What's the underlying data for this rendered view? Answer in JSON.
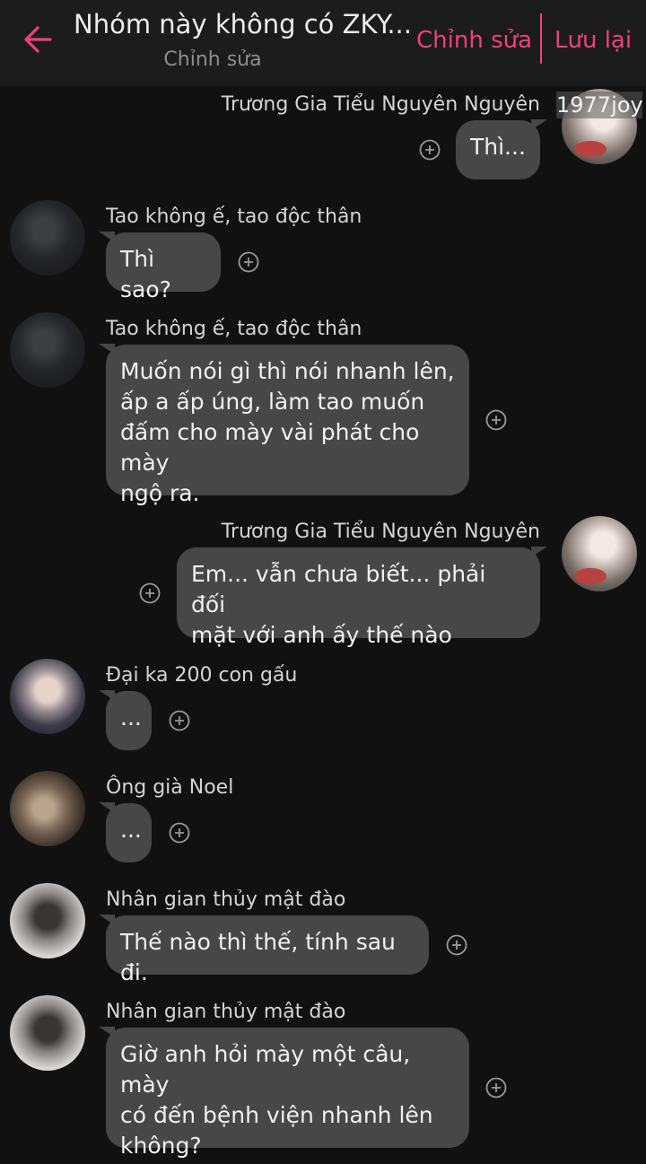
{
  "header": {
    "title": "Nhóm này không có ZKY...",
    "subtitle": "Chỉnh sửa",
    "edit_label": "Chỉnh sửa",
    "save_label": "Lưu lại",
    "accent_color": "#f0407a"
  },
  "watermark": "1977joy",
  "messages": [
    {
      "sender": "Trương Gia Tiểu Nguyên Nguyên",
      "side": "right",
      "lines": [
        "Thì..."
      ]
    },
    {
      "sender": "Tao không ế, tao độc thân",
      "side": "left",
      "lines": [
        "Thì sao?"
      ]
    },
    {
      "sender": "Tao không ế, tao độc thân",
      "side": "left",
      "lines": [
        "Muốn nói gì thì nói nhanh lên,",
        "ấp a ấp úng, làm tao muốn",
        "đấm cho mày vài phát cho mày",
        "ngộ ra."
      ]
    },
    {
      "sender": "Trương Gia Tiểu Nguyên Nguyên",
      "side": "right",
      "lines": [
        "Em... vẫn chưa biết... phải đối",
        "mặt với anh ấy thế nào"
      ]
    },
    {
      "sender": "Đại ka 200 con gấu",
      "side": "left",
      "lines": [
        "..."
      ]
    },
    {
      "sender": "Ông già Noel",
      "side": "left",
      "lines": [
        "..."
      ]
    },
    {
      "sender": "Nhân gian thủy mật đào",
      "side": "left",
      "lines": [
        "Thế nào thì thế, tính sau đi."
      ]
    },
    {
      "sender": "Nhân gian thủy mật đào",
      "side": "left",
      "lines": [
        "Giờ anh hỏi mày một câu, mày",
        "có đến bệnh viện nhanh lên",
        "không?"
      ]
    }
  ]
}
